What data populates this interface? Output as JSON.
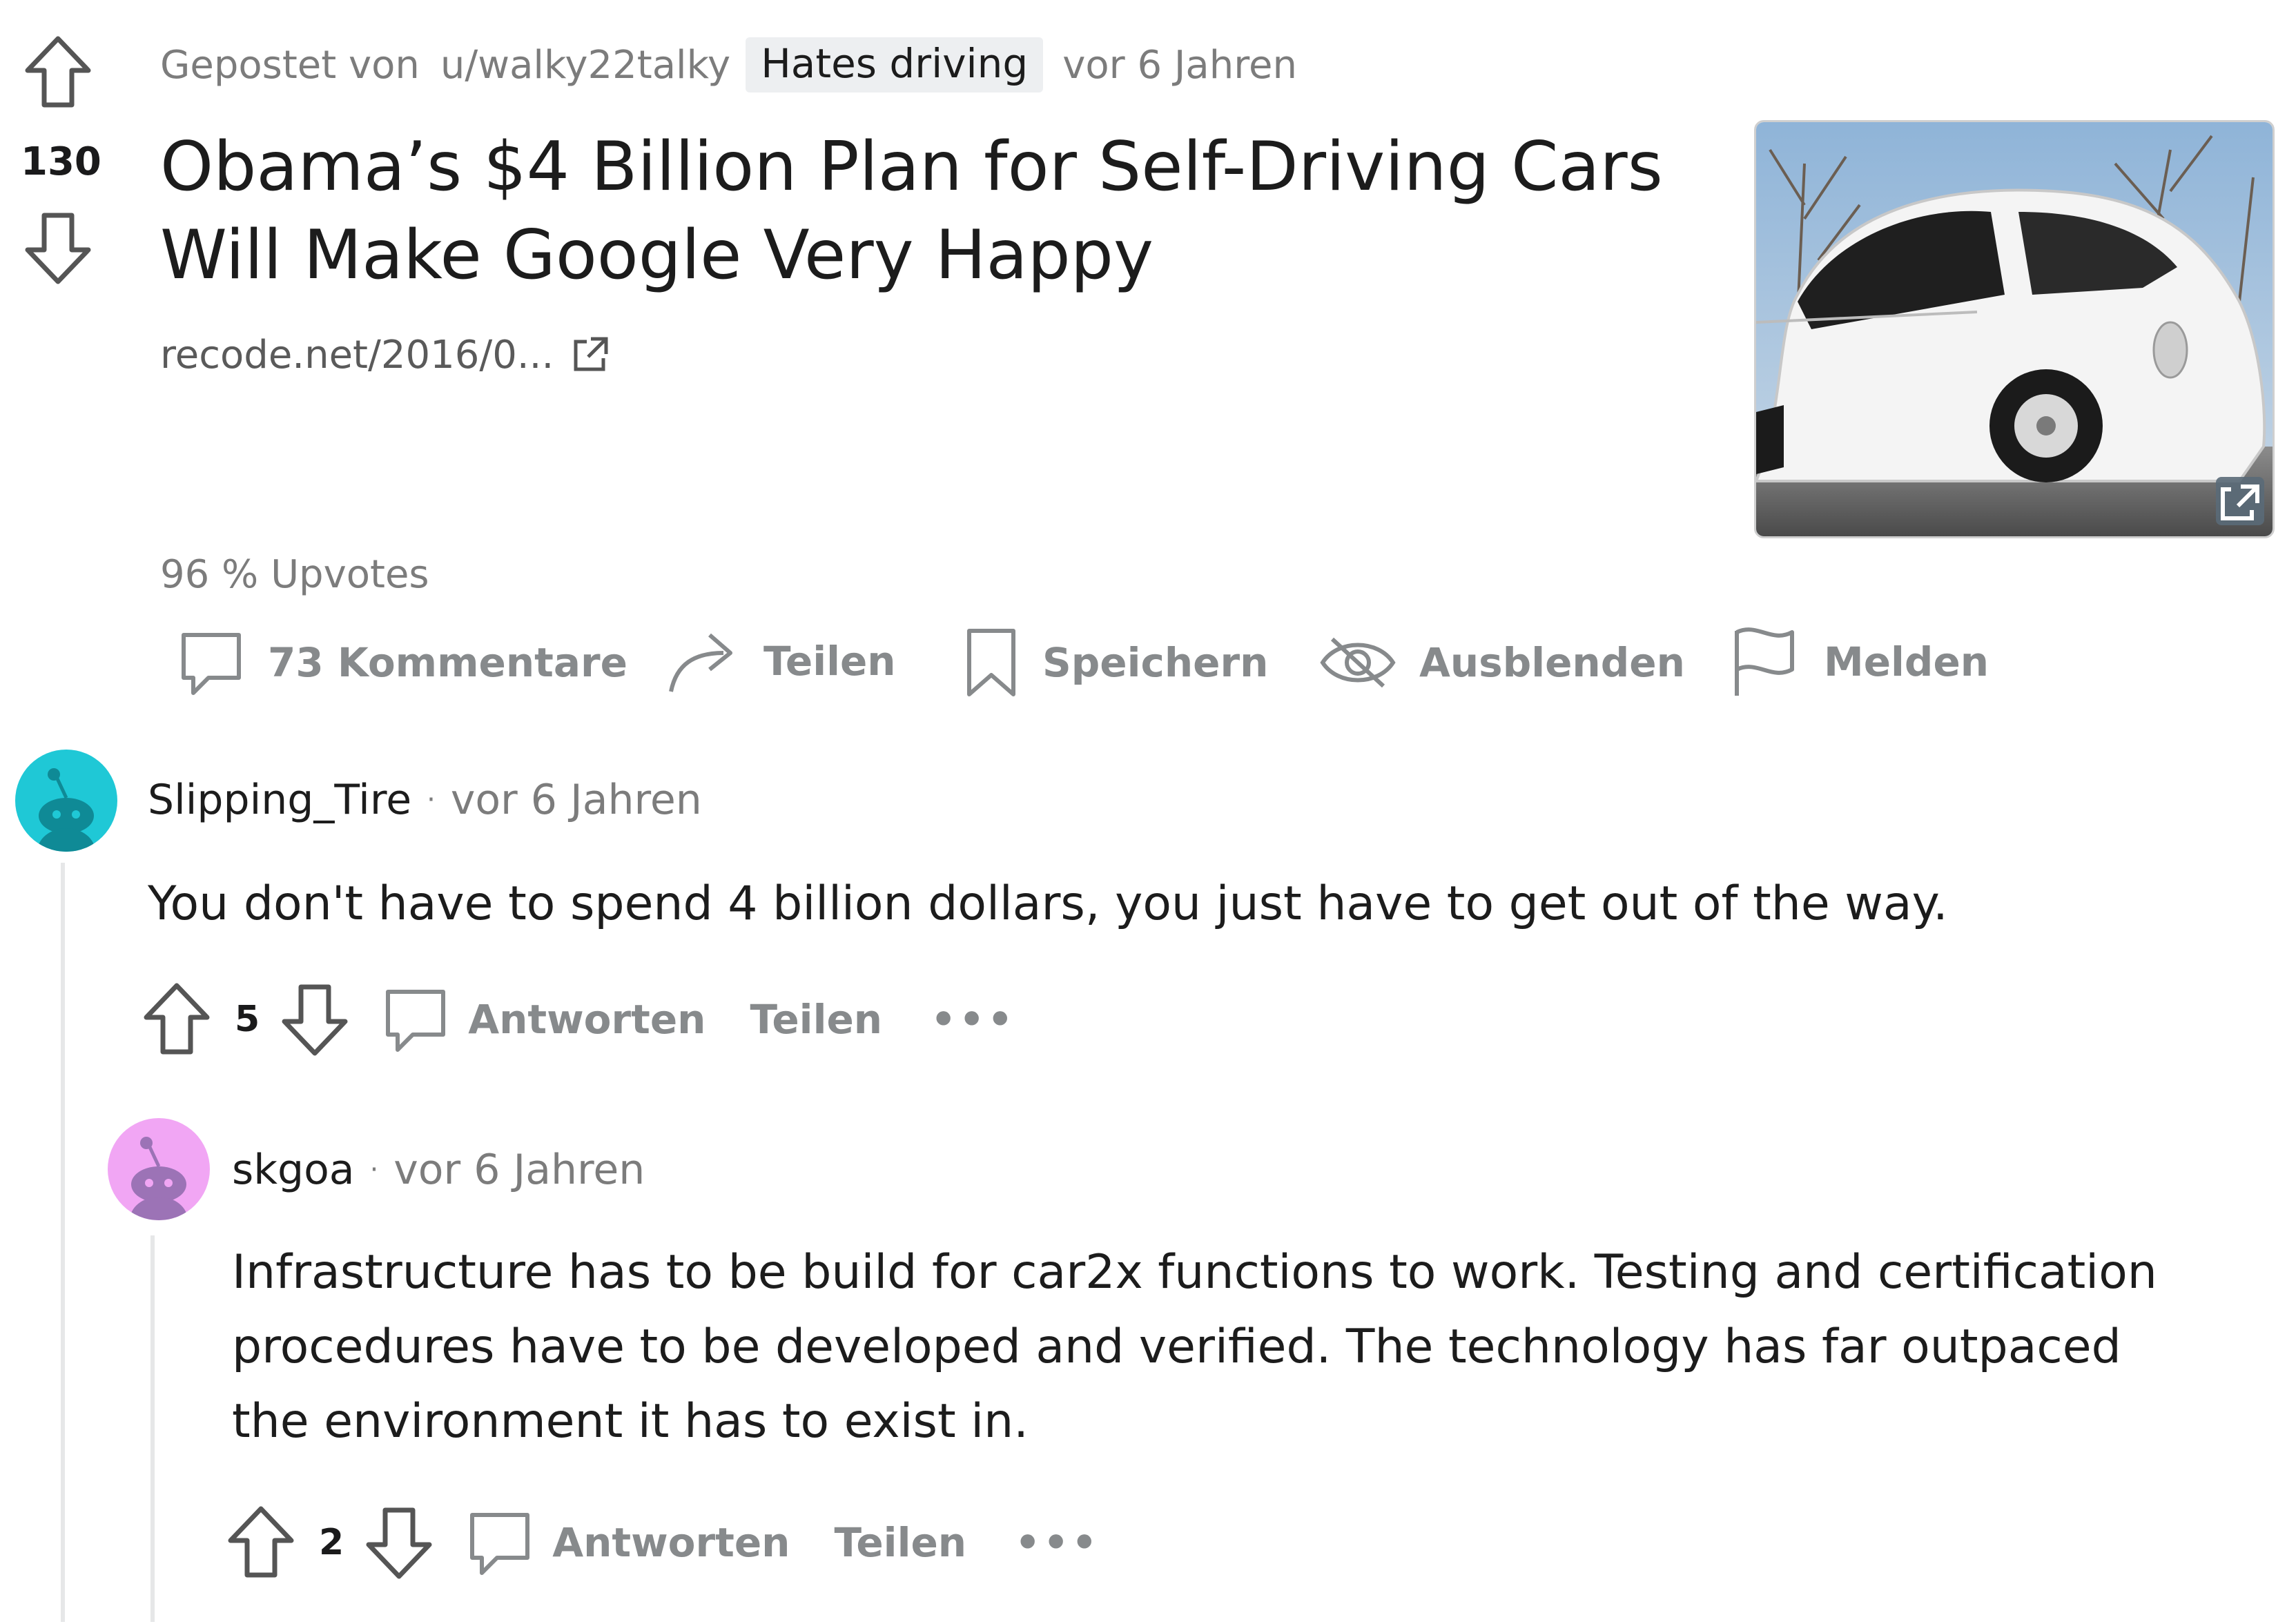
{
  "post": {
    "posted_by_prefix": "Gepostet von",
    "author": "u/walky22talky",
    "flair": "Hates driving",
    "time": "vor 6 Jahren",
    "score": "130",
    "title_line1": "Obama’s $4 Billion Plan for Self-Driving Cars",
    "title_line2": "Will Make Google Very Happy",
    "link_text": "recode.net/2016/0...",
    "upvote_ratio": "96 % Upvotes",
    "actions": {
      "comments": "73 Kommentare",
      "share": "Teilen",
      "save": "Speichern",
      "hide": "Ausblenden",
      "report": "Melden"
    }
  },
  "comments": [
    {
      "author": "Slipping_Tire",
      "time": "vor 6 Jahren",
      "text": "You don't have to spend 4 billion dollars, you just have to get out of the way.",
      "score": "5",
      "reply_label": "Antworten",
      "share_label": "Teilen",
      "more": "•••",
      "avatar_color": "#1fc8d6"
    },
    {
      "author": "skgoa",
      "time": "vor 6 Jahren",
      "text_line1": "Infrastructure has to be build for car2x functions to work. Testing and certification",
      "text_line2": "procedures have to be developed and verified. The technology has far outpaced",
      "text_line3": "the environment it has to exist in.",
      "score": "2",
      "reply_label": "Antworten",
      "share_label": "Teilen",
      "more": "•••",
      "avatar_color": "#f1a6f4"
    }
  ],
  "colors": {
    "meta_text": "#7c7c7c",
    "action_text": "#878a8c",
    "flair_bg": "#edeff1"
  }
}
